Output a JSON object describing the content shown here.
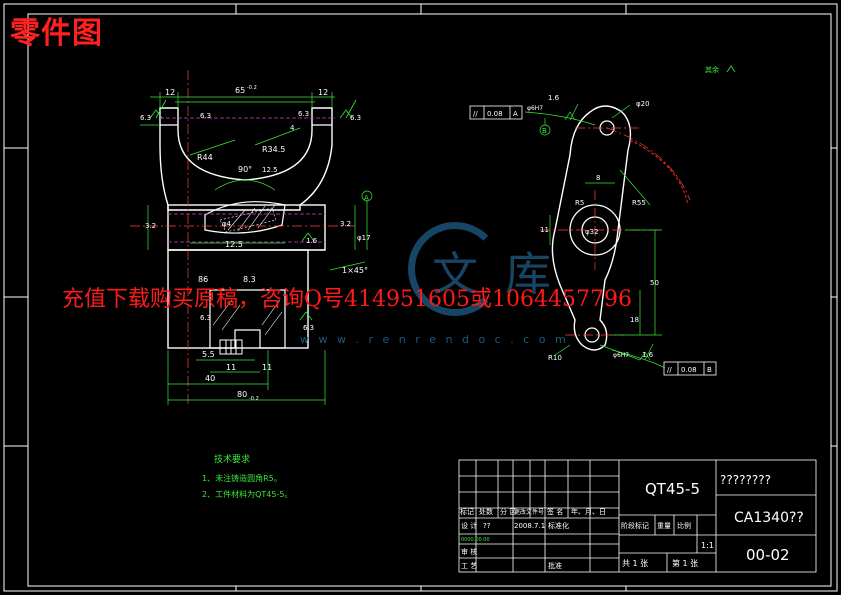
{
  "sheet_title": "零件图",
  "watermark": {
    "text": "充值下载购买原稿，咨询Q号414951605或1064457796",
    "url": "w w w . r e n r e n d o c . c o m",
    "logo_chars": [
      "文",
      "库"
    ]
  },
  "front_view_dims": {
    "d12_top": "12",
    "d65": "65",
    "d65_tol": "-0.2",
    "d12_right": "12",
    "d63_a": "6.3",
    "d63_b": "6.3",
    "d63_right": "6.3",
    "d63_far": "6.3",
    "d4": "4",
    "r34": "R34.5",
    "r44": "R44",
    "a90": "90°",
    "d125a": "12.5",
    "d32a": "3.2",
    "phi4": "φ4",
    "d125b": "12.5",
    "d16": "1.6",
    "d32b": "3.2",
    "phi17": "φ17",
    "datum_a": "A",
    "chamfer": "1×45°",
    "d86": "86",
    "d83": "8.3",
    "d63_c": "6.3",
    "d63_d": "6.3",
    "d55": "5.5",
    "d11a": "11",
    "d11b": "11",
    "d40": "40",
    "d80": "80",
    "d80_tol": "-0.2"
  },
  "side_view_dims": {
    "tol_top_flat": "//",
    "tol_top_val": "0.08",
    "tol_top_ref": "A",
    "fit_top": "φ6H7",
    "ra_top": "1.6",
    "datum_b": "B",
    "phi20": "φ20",
    "d8": "8",
    "r55": "R55",
    "d11": "11",
    "phi32": "φ32",
    "r5": "R5",
    "d50": "50",
    "d18": "18",
    "r10": "R10",
    "fit_bottom": "φ6H7",
    "ra_bottom": "1.6",
    "tol_bot_flat": "//",
    "tol_bot_val": "0.08",
    "tol_bot_ref": "B",
    "remaining": "其余"
  },
  "tech_requirements": {
    "heading": "技术要求",
    "items": [
      "1、未注铸造圆角R5。",
      "2、工件材料为QT45-5。"
    ]
  },
  "title_block": {
    "material": "QT45-5",
    "part_name": "????????",
    "machine": "CA1340??",
    "drawing_no": "00-02",
    "scale": "1:1",
    "rev_header": [
      "标记",
      "处数",
      "分 区",
      "更改文件号",
      "签 名",
      "年、月、日"
    ],
    "design_label": "设 计",
    "design_name": "??",
    "design_date": "2008.7.1",
    "std_label": "标准化",
    "stage_label": "阶段标记",
    "weight_label": "重量",
    "scale_label": "比例",
    "review_label": "审 核",
    "process_label": "工 艺",
    "approve_label": "批准",
    "sheet_count": "共 1 张",
    "sheet_no": "第 1 张",
    "small_note": "0000.00.00"
  }
}
